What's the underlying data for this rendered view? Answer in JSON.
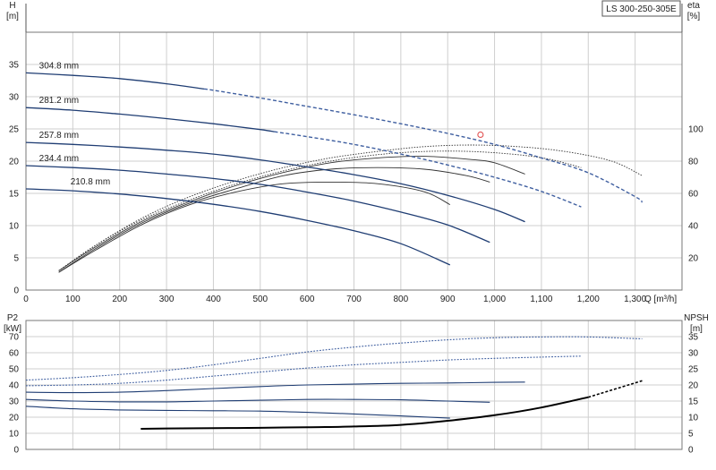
{
  "chart_data": [
    {
      "type": "line",
      "title": "LS 300-250-305E",
      "xlabel": "Q [m³/h]",
      "ylabel": "H [m]",
      "y2label": "eta [%]",
      "xlim": [
        0,
        1400
      ],
      "ylim": [
        0,
        40
      ],
      "y2lim": [
        0,
        160
      ],
      "xticks": [
        0,
        100,
        200,
        300,
        400,
        500,
        600,
        700,
        800,
        900,
        1000,
        1100,
        1200,
        1300
      ],
      "xtick_labels": [
        "0",
        "100",
        "200",
        "300",
        "400",
        "500",
        "600",
        "700",
        "800",
        "900",
        "1,000",
        "1,100",
        "1,200",
        "1,300"
      ],
      "yticks": [
        0,
        5,
        10,
        15,
        20,
        25,
        30,
        35
      ],
      "y2ticks": [
        20,
        40,
        60,
        80,
        100
      ],
      "grid": true,
      "duty_point": {
        "x": 970,
        "y": 24.1
      },
      "head_series": [
        {
          "name": "304.8 mm",
          "style": "solid-dashed",
          "dash_from": 380,
          "points": [
            [
              0,
              33.7
            ],
            [
              100,
              33.3
            ],
            [
              200,
              32.8
            ],
            [
              300,
              32.0
            ],
            [
              400,
              31.0
            ],
            [
              500,
              29.8
            ],
            [
              600,
              28.5
            ],
            [
              700,
              27.2
            ],
            [
              800,
              25.8
            ],
            [
              900,
              24.3
            ],
            [
              1000,
              22.6
            ],
            [
              1100,
              20.5
            ],
            [
              1200,
              18.2
            ],
            [
              1300,
              14.5
            ],
            [
              1315,
              13.6
            ]
          ]
        },
        {
          "name": "281.2 mm",
          "style": "solid-dashed",
          "dash_from": 530,
          "points": [
            [
              0,
              28.3
            ],
            [
              100,
              27.9
            ],
            [
              200,
              27.3
            ],
            [
              300,
              26.6
            ],
            [
              400,
              25.8
            ],
            [
              500,
              24.9
            ],
            [
              600,
              23.8
            ],
            [
              700,
              22.6
            ],
            [
              800,
              21.1
            ],
            [
              900,
              19.4
            ],
            [
              1000,
              17.5
            ],
            [
              1100,
              15.3
            ],
            [
              1185,
              12.9
            ]
          ]
        },
        {
          "name": "257.8 mm",
          "style": "solid",
          "points": [
            [
              0,
              22.9
            ],
            [
              100,
              22.6
            ],
            [
              200,
              22.2
            ],
            [
              300,
              21.7
            ],
            [
              400,
              21.1
            ],
            [
              500,
              20.2
            ],
            [
              600,
              19.1
            ],
            [
              700,
              17.9
            ],
            [
              800,
              16.5
            ],
            [
              900,
              14.7
            ],
            [
              1000,
              12.5
            ],
            [
              1065,
              10.6
            ]
          ]
        },
        {
          "name": "234.4 mm",
          "style": "solid",
          "points": [
            [
              0,
              19.3
            ],
            [
              100,
              19.0
            ],
            [
              200,
              18.6
            ],
            [
              300,
              18.0
            ],
            [
              400,
              17.3
            ],
            [
              500,
              16.4
            ],
            [
              600,
              15.2
            ],
            [
              700,
              13.8
            ],
            [
              800,
              12.1
            ],
            [
              900,
              10.1
            ],
            [
              990,
              7.4
            ]
          ]
        },
        {
          "name": "210.8 mm",
          "style": "solid",
          "points": [
            [
              0,
              15.7
            ],
            [
              100,
              15.4
            ],
            [
              200,
              14.9
            ],
            [
              300,
              14.2
            ],
            [
              400,
              13.3
            ],
            [
              500,
              12.2
            ],
            [
              600,
              10.8
            ],
            [
              700,
              9.2
            ],
            [
              800,
              7.2
            ],
            [
              905,
              3.9
            ]
          ]
        }
      ],
      "eta_series": [
        {
          "style": "dotted",
          "points": [
            [
              70,
              12
            ],
            [
              150,
              28
            ],
            [
              250,
              45
            ],
            [
              350,
              58
            ],
            [
              450,
              68
            ],
            [
              550,
              76
            ],
            [
              650,
              82
            ],
            [
              750,
              86
            ],
            [
              850,
              89
            ],
            [
              950,
              90
            ],
            [
              1050,
              89
            ],
            [
              1150,
              86
            ],
            [
              1250,
              80
            ],
            [
              1315,
              71
            ]
          ]
        },
        {
          "style": "dotted",
          "points": [
            [
              70,
              12
            ],
            [
              150,
              28
            ],
            [
              250,
              44
            ],
            [
              350,
              56
            ],
            [
              450,
              66
            ],
            [
              550,
              74
            ],
            [
              650,
              80
            ],
            [
              750,
              84
            ],
            [
              850,
              86
            ],
            [
              950,
              86
            ],
            [
              1050,
              84
            ],
            [
              1120,
              81
            ],
            [
              1185,
              76
            ]
          ]
        },
        {
          "style": "solid",
          "points": [
            [
              70,
              12
            ],
            [
              150,
              27
            ],
            [
              250,
              43
            ],
            [
              350,
              55
            ],
            [
              450,
              65
            ],
            [
              550,
              73
            ],
            [
              650,
              79
            ],
            [
              750,
              82
            ],
            [
              850,
              83
            ],
            [
              950,
              81
            ],
            [
              1000,
              79
            ],
            [
              1065,
              72
            ]
          ]
        },
        {
          "style": "solid",
          "points": [
            [
              70,
              11
            ],
            [
              150,
              26
            ],
            [
              250,
              42
            ],
            [
              350,
              54
            ],
            [
              450,
              63
            ],
            [
              550,
              71
            ],
            [
              650,
              75
            ],
            [
              750,
              76
            ],
            [
              850,
              75
            ],
            [
              940,
              71
            ],
            [
              990,
              67
            ]
          ]
        },
        {
          "style": "solid",
          "points": [
            [
              70,
              11
            ],
            [
              150,
              25
            ],
            [
              250,
              41
            ],
            [
              350,
              53
            ],
            [
              450,
              61
            ],
            [
              550,
              66
            ],
            [
              650,
              67
            ],
            [
              750,
              66
            ],
            [
              850,
              61
            ],
            [
              905,
              53
            ]
          ]
        }
      ]
    },
    {
      "type": "line",
      "xlabel": "",
      "ylabel": "P2 [kW]",
      "y2label": "NPSH [m]",
      "xlim": [
        0,
        1400
      ],
      "ylim": [
        0,
        80
      ],
      "y2lim": [
        0,
        40
      ],
      "yticks": [
        0,
        10,
        20,
        30,
        40,
        50,
        60,
        70
      ],
      "y2ticks": [
        0,
        5,
        10,
        15,
        20,
        25,
        30,
        35
      ],
      "grid": true,
      "power_series": [
        {
          "name": "304.8 mm",
          "style": "dotted",
          "points": [
            [
              0,
              43
            ],
            [
              100,
              44.5
            ],
            [
              200,
              46.5
            ],
            [
              300,
              49
            ],
            [
              400,
              52.5
            ],
            [
              500,
              56.5
            ],
            [
              600,
              60.5
            ],
            [
              700,
              63.5
            ],
            [
              800,
              66
            ],
            [
              900,
              68
            ],
            [
              1000,
              69.3
            ],
            [
              1100,
              69.8
            ],
            [
              1200,
              69.8
            ],
            [
              1315,
              68.6
            ]
          ]
        },
        {
          "name": "281.2 mm",
          "style": "dotted",
          "points": [
            [
              0,
              39.5
            ],
            [
              100,
              40
            ],
            [
              200,
              41
            ],
            [
              300,
              43
            ],
            [
              400,
              45.5
            ],
            [
              500,
              48
            ],
            [
              600,
              50.5
            ],
            [
              700,
              52.5
            ],
            [
              800,
              54
            ],
            [
              900,
              55.5
            ],
            [
              1000,
              56.5
            ],
            [
              1100,
              57.3
            ],
            [
              1185,
              57.9
            ]
          ]
        },
        {
          "name": "257.8 mm",
          "style": "solid",
          "points": [
            [
              0,
              35.5
            ],
            [
              100,
              35.2
            ],
            [
              200,
              35.5
            ],
            [
              300,
              36.5
            ],
            [
              400,
              37.8
            ],
            [
              500,
              39
            ],
            [
              600,
              40
            ],
            [
              700,
              40.5
            ],
            [
              800,
              41
            ],
            [
              900,
              41.2
            ],
            [
              1000,
              41.6
            ],
            [
              1065,
              41.8
            ]
          ]
        },
        {
          "name": "234.4 mm",
          "style": "solid",
          "points": [
            [
              0,
              31
            ],
            [
              100,
              30
            ],
            [
              200,
              29.5
            ],
            [
              300,
              29.5
            ],
            [
              400,
              30
            ],
            [
              500,
              30.5
            ],
            [
              600,
              31
            ],
            [
              700,
              31
            ],
            [
              800,
              30.8
            ],
            [
              900,
              30
            ],
            [
              990,
              29.3
            ]
          ]
        },
        {
          "name": "210.8 mm",
          "style": "solid",
          "points": [
            [
              0,
              26.8
            ],
            [
              100,
              25.2
            ],
            [
              200,
              24.5
            ],
            [
              300,
              24.2
            ],
            [
              400,
              24
            ],
            [
              500,
              23.8
            ],
            [
              600,
              23
            ],
            [
              700,
              22
            ],
            [
              800,
              20.8
            ],
            [
              905,
              19.4
            ]
          ]
        }
      ],
      "npsh_series": [
        {
          "style": "solid-dashed",
          "dash_from": 1200,
          "points": [
            [
              245,
              6.4
            ],
            [
              300,
              6.5
            ],
            [
              400,
              6.6
            ],
            [
              500,
              6.7
            ],
            [
              600,
              6.9
            ],
            [
              700,
              7.1
            ],
            [
              800,
              7.6
            ],
            [
              900,
              8.9
            ],
            [
              1000,
              10.6
            ],
            [
              1100,
              13.0
            ],
            [
              1200,
              16.2
            ],
            [
              1315,
              21.3
            ]
          ]
        }
      ]
    }
  ],
  "colors": {
    "curve": "#1f3d73",
    "curve_light": "#3f5fa0",
    "eta": "#333333",
    "npsh": "#000000",
    "duty_point": "#e05050"
  }
}
